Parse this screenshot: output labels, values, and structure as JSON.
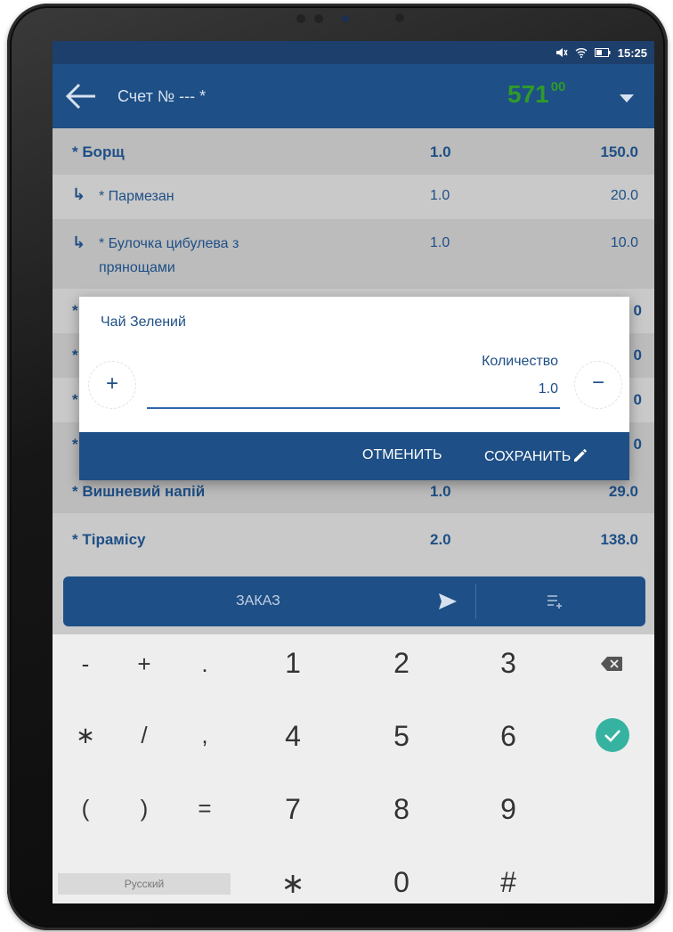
{
  "status_bar": {
    "time": "15:25"
  },
  "app_bar": {
    "title": "Счет № --- *",
    "total_main": "571",
    "total_cents": "00"
  },
  "rows": [
    {
      "name": "* Борщ",
      "qty": "1.0",
      "price": "150.0"
    },
    {
      "name": "* Пармезан",
      "qty": "1.0",
      "price": "20.0"
    },
    {
      "name": "* Булочка цибулева з прянощами",
      "qty": "1.0",
      "price": "10.0"
    },
    {
      "name": "* Вишневий напій",
      "qty": "1.0",
      "price": "29.0"
    },
    {
      "name": "* Тірамісу",
      "qty": "2.0",
      "price": "138.0"
    }
  ],
  "partial_prices": [
    "0",
    "0",
    "0",
    "0"
  ],
  "dialog": {
    "title": "Чай Зелений",
    "plus": "+",
    "minus": "−",
    "field_label": "Количество",
    "field_value": "1.0",
    "cancel_label": "ОТМЕНИТЬ",
    "save_label": "СОХРАНИТЬ"
  },
  "order_bar": {
    "label": "ЗАКАЗ"
  },
  "keyboard": {
    "symbols": [
      "-",
      "+",
      ".",
      "∗",
      "/",
      ",",
      "(",
      ")",
      "="
    ],
    "digits": [
      "1",
      "2",
      "3",
      "4",
      "5",
      "6",
      "7",
      "8",
      "9"
    ],
    "bottom": [
      "∗",
      "0",
      "#"
    ],
    "language": "Русский"
  },
  "colors": {
    "app_bar": "#1e4f86",
    "status_bar": "#1d3f6c",
    "total": "#2f9a2a",
    "enter_key": "#36b3a0"
  },
  "icons": {
    "back": "arrow-left-icon",
    "dropdown": "caret-down-icon",
    "send": "send-icon",
    "add_list": "playlist-add-icon",
    "backspace": "backspace-icon",
    "enter": "check-circle-icon",
    "edit": "pencil-icon"
  }
}
